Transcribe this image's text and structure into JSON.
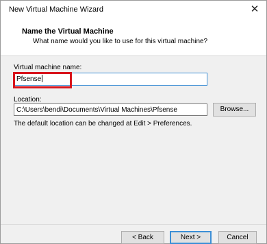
{
  "window": {
    "title": "New Virtual Machine Wizard",
    "close_glyph": "✕"
  },
  "header": {
    "title": "Name the Virtual Machine",
    "subtitle": "What name would you like to use for this virtual machine?"
  },
  "vm_name": {
    "label": "Virtual machine name:",
    "value": "Pfsense"
  },
  "location": {
    "label": "Location:",
    "value": "C:\\Users\\bendi\\Documents\\Virtual Machines\\Pfsense",
    "browse_label": "Browse...",
    "hint": "The default location can be changed at Edit > Preferences."
  },
  "buttons": {
    "back": "< Back",
    "next": "Next >",
    "cancel": "Cancel"
  },
  "colors": {
    "highlight": "#d8141c",
    "focus": "#3c8fd6"
  }
}
